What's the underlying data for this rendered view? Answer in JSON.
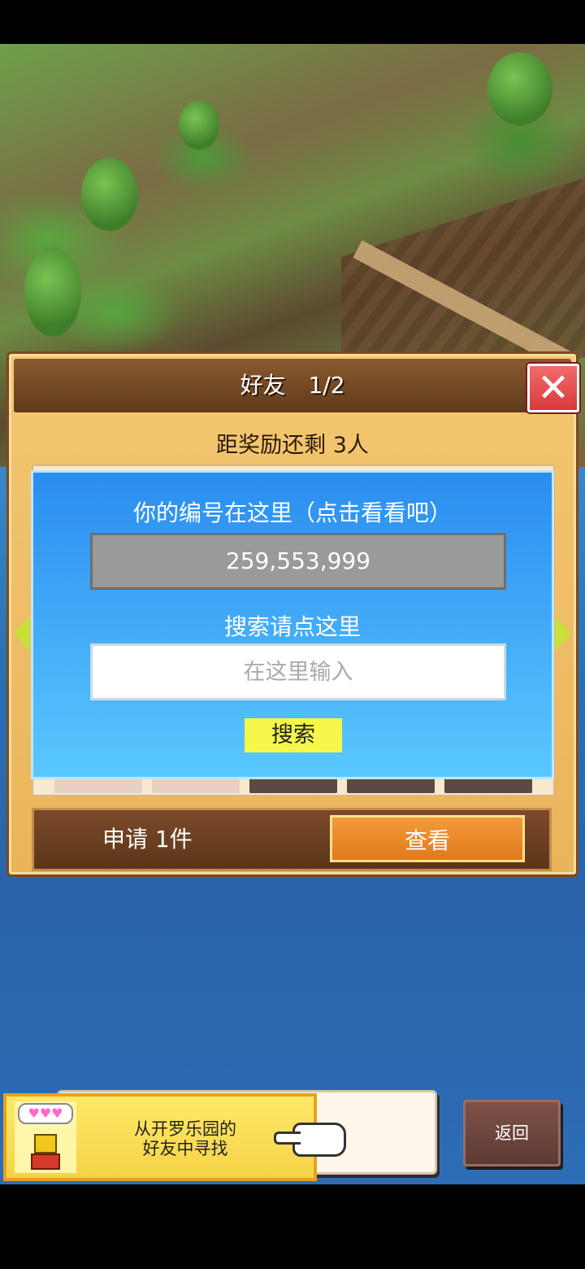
{
  "panel": {
    "title": "好友　1/2",
    "close_label": "✕",
    "reward_text": "距奖励还剩 3人"
  },
  "search_dialog": {
    "id_label": "你的编号在这里（点击看看吧）",
    "id_value": "259,553,999",
    "search_label": "搜索请点这里",
    "search_placeholder": "在这里输入",
    "search_button": "搜索"
  },
  "requests": {
    "text": "申请 1件",
    "view_button": "查看"
  },
  "hint": {
    "text": "从开罗乐园的\n好友中寻找",
    "hearts": "♥♥♥"
  },
  "back_button": "返回",
  "colors": {
    "dialog_blue": "#2a8df0",
    "search_button": "#f4f74a",
    "view_button": "#e07a1c",
    "close_button": "#d63a3a"
  }
}
